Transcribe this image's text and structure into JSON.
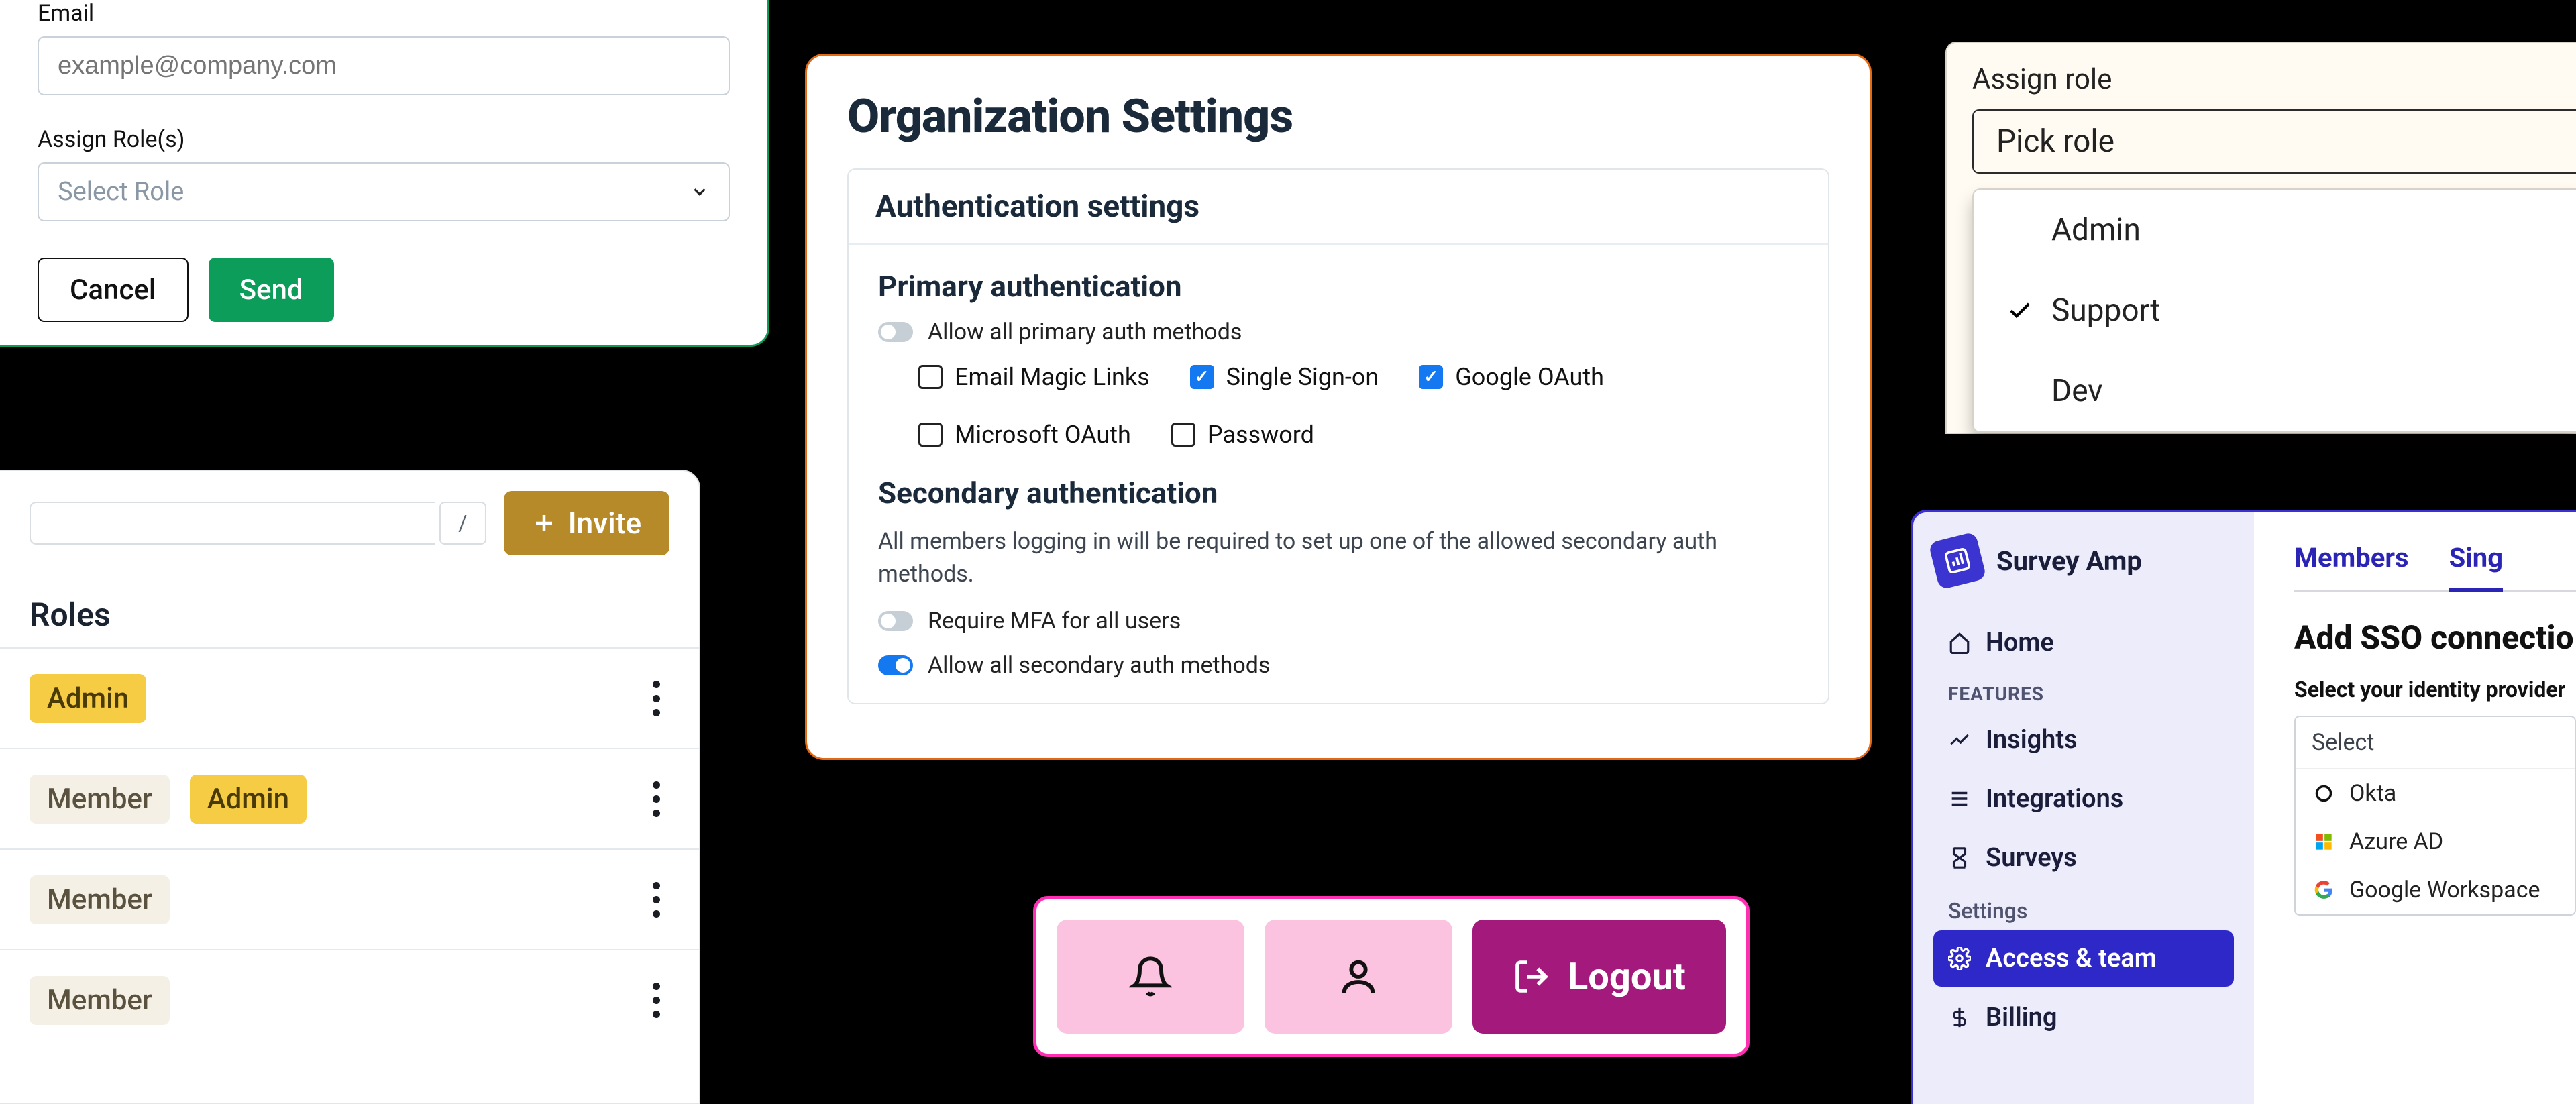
{
  "invite_form": {
    "email_label": "Email",
    "email_placeholder": "example@company.com",
    "roles_label": "Assign Role(s)",
    "roles_placeholder": "Select Role",
    "cancel_label": "Cancel",
    "send_label": "Send"
  },
  "roles_panel": {
    "slash_hint": "/",
    "invite_label": "Invite",
    "heading": "Roles",
    "rows": [
      {
        "badges": [
          "Admin"
        ]
      },
      {
        "badges": [
          "Member",
          "Admin"
        ]
      },
      {
        "badges": [
          "Member"
        ]
      },
      {
        "badges": [
          "Member"
        ]
      }
    ]
  },
  "org_settings": {
    "title": "Organization Settings",
    "card_heading": "Authentication settings",
    "primary": {
      "title": "Primary authentication",
      "allow_all_label": "Allow all primary auth methods",
      "methods": [
        {
          "label": "Email Magic Links",
          "checked": false
        },
        {
          "label": "Single Sign-on",
          "checked": true
        },
        {
          "label": "Google OAuth",
          "checked": true
        },
        {
          "label": "Microsoft OAuth",
          "checked": false
        },
        {
          "label": "Password",
          "checked": false
        }
      ]
    },
    "secondary": {
      "title": "Secondary authentication",
      "desc": "All members logging in will be required to set up one of the allowed secondary auth methods.",
      "require_mfa_label": "Require MFA for all users",
      "allow_all_label": "Allow all secondary auth methods"
    }
  },
  "assign_role": {
    "label": "Assign role",
    "placeholder": "Pick role",
    "options": [
      {
        "label": "Admin",
        "selected": false
      },
      {
        "label": "Support",
        "selected": true
      },
      {
        "label": "Dev",
        "selected": false
      }
    ]
  },
  "logout_bar": {
    "logout_label": "Logout"
  },
  "survey_app": {
    "brand": "Survey Amp",
    "nav": {
      "home": "Home",
      "features_label": "FEATURES",
      "insights": "Insights",
      "integrations": "Integrations",
      "surveys": "Surveys",
      "settings_label": "Settings",
      "access_team": "Access & team",
      "billing": "Billing"
    },
    "tabs": {
      "members": "Members",
      "single": "Sing"
    },
    "sso": {
      "heading": "Add SSO connectio",
      "sublabel": "Select your identity provider",
      "select_placeholder": "Select",
      "providers": [
        "Okta",
        "Azure AD",
        "Google Workspace"
      ]
    }
  }
}
